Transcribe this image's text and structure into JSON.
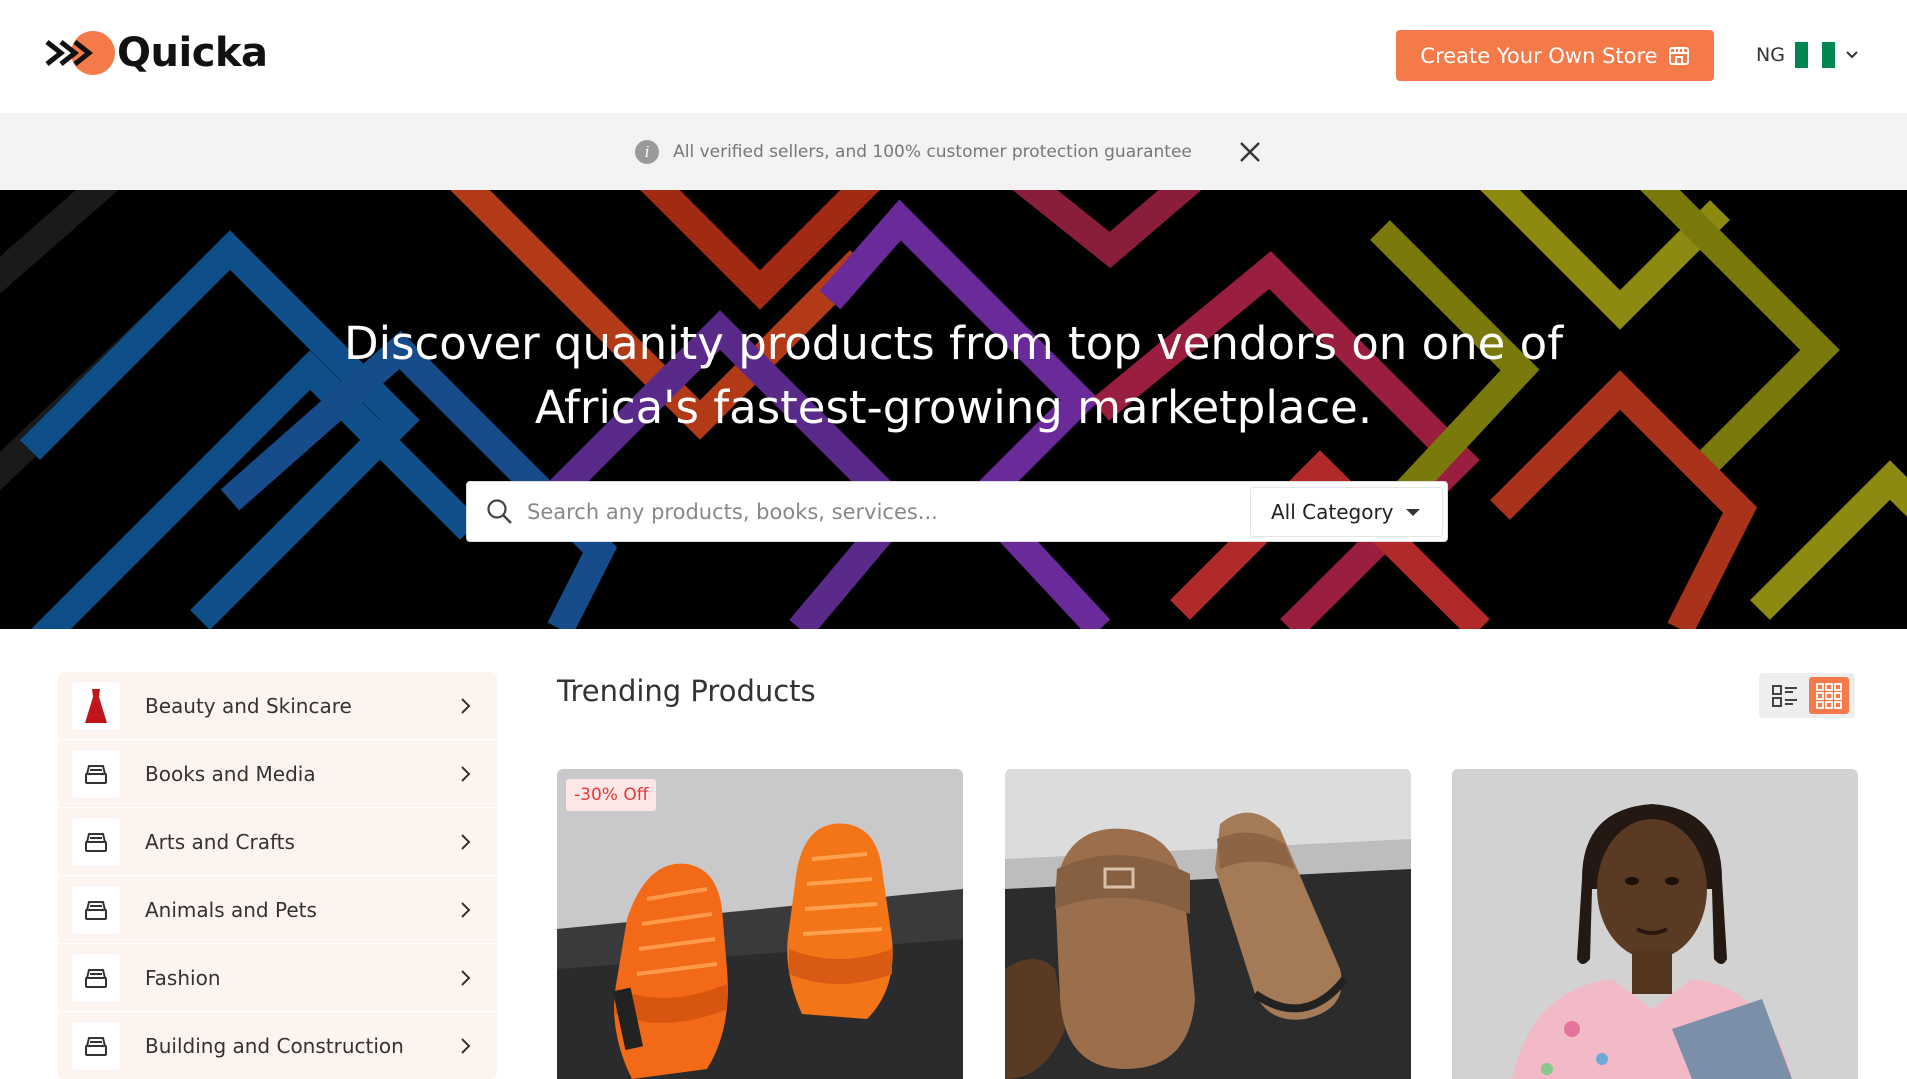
{
  "header": {
    "logo_text": "Quicka",
    "cta_label": "Create Your Own Store",
    "locale_code": "NG",
    "brand_color": "#f47a4a"
  },
  "notice": {
    "text": "All verified sellers, and 100% customer protection guarantee",
    "icon": "info-icon"
  },
  "hero": {
    "title_line1": "Discover quanity products from top vendors on one of",
    "title_line2": "Africa's fastest-growing marketplace.",
    "search_placeholder": "Search any products, books, services...",
    "category_selected": "All Category"
  },
  "sidebar": {
    "items": [
      {
        "label": "Beauty and Skincare",
        "icon": "dress-icon"
      },
      {
        "label": "Books and Media",
        "icon": "category-icon"
      },
      {
        "label": "Arts and Crafts",
        "icon": "category-icon"
      },
      {
        "label": "Animals and Pets",
        "icon": "category-icon"
      },
      {
        "label": "Fashion",
        "icon": "category-icon"
      },
      {
        "label": "Building and Construction",
        "icon": "category-icon"
      }
    ]
  },
  "main": {
    "section_title": "Trending Products",
    "view_modes": [
      "list-view-icon",
      "grid-view-icon"
    ],
    "active_view": "grid",
    "products": [
      {
        "badge": "-30% Off",
        "image": "orange-sneakers"
      },
      {
        "badge": "",
        "image": "suede-clogs"
      },
      {
        "badge": "",
        "image": "woman-portrait"
      }
    ]
  }
}
